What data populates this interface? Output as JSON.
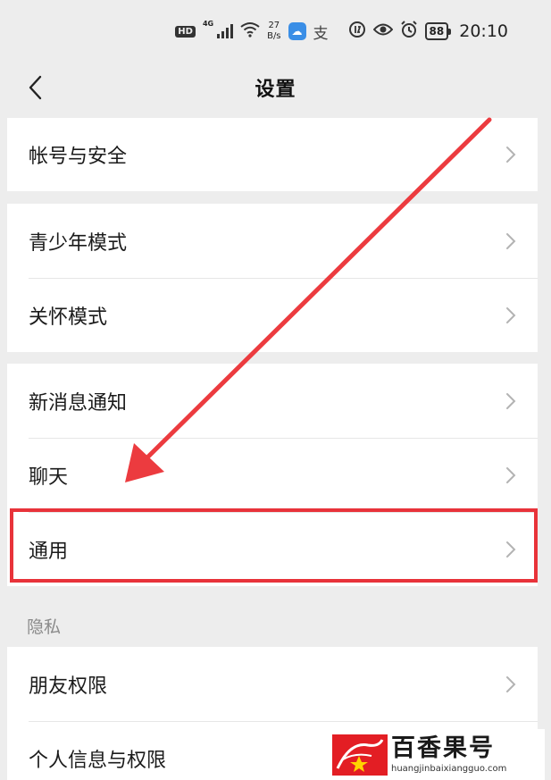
{
  "status_bar": {
    "hd": "HD",
    "network": "4G",
    "speed_value": "27",
    "speed_unit": "B/s",
    "app_badge": "☁",
    "zhi": "支",
    "battery": "88",
    "time": "20:10"
  },
  "nav": {
    "title": "设置"
  },
  "groups": [
    {
      "items": [
        {
          "label": "帐号与安全"
        }
      ]
    },
    {
      "items": [
        {
          "label": "青少年模式"
        },
        {
          "label": "关怀模式"
        }
      ]
    },
    {
      "items": [
        {
          "label": "新消息通知"
        },
        {
          "label": "聊天"
        },
        {
          "label": "通用"
        }
      ]
    },
    {
      "header": "隐私",
      "items": [
        {
          "label": "朋友权限"
        },
        {
          "label": "个人信息与权限"
        }
      ]
    }
  ],
  "annotation": {
    "highlight_color": "#e8333a"
  },
  "watermark": {
    "title": "百香果号",
    "url": "huangjinbaixiangguo.com"
  }
}
